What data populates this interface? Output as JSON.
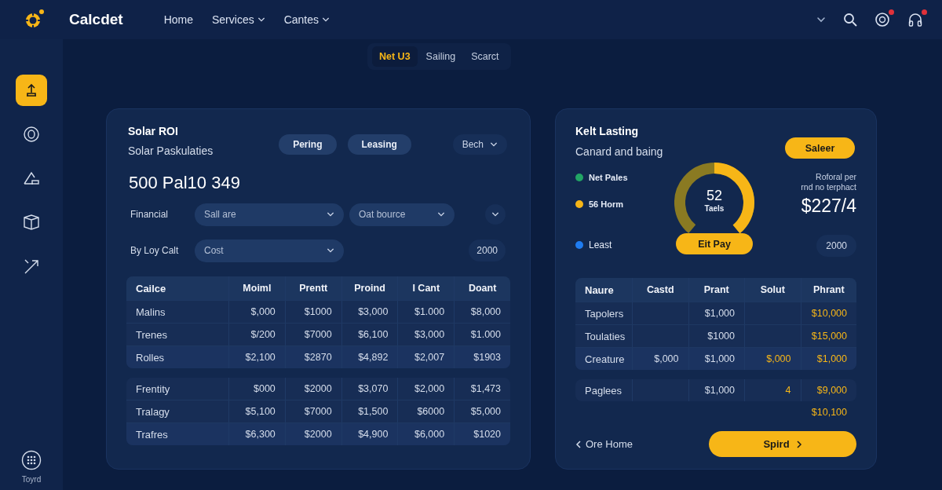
{
  "header": {
    "brand": "Calcdet",
    "nav": [
      {
        "label": "Home",
        "dropdown": false
      },
      {
        "label": "Services",
        "dropdown": true
      },
      {
        "label": "Cantes",
        "dropdown": true
      }
    ],
    "actions": [
      {
        "kind": "chevron",
        "alert": false
      },
      {
        "kind": "search",
        "alert": false
      },
      {
        "kind": "support",
        "alert": true
      },
      {
        "kind": "headset",
        "alert": true
      }
    ]
  },
  "sidebar": {
    "items": [
      {
        "kind": "upload",
        "selected": true
      },
      {
        "kind": "circle",
        "selected": false
      },
      {
        "kind": "triangle",
        "selected": false
      },
      {
        "kind": "box",
        "selected": false
      },
      {
        "kind": "arrow",
        "selected": false
      }
    ],
    "footer": "Toyrd"
  },
  "subtabs": [
    {
      "label": "Net U3",
      "selected": true
    },
    {
      "label": "Sailing",
      "selected": false
    },
    {
      "label": "Scarct",
      "selected": false
    }
  ],
  "roi_card": {
    "title": "Solar ROI",
    "subtitle": "Solar Paskulaties",
    "toggles": [
      "Pering",
      "Leasing"
    ],
    "period": "Bech",
    "figure": "500 Pal10 349",
    "fields": [
      {
        "label": "Financial",
        "selects": [
          "Sall are",
          "Oat bource"
        ],
        "kind": "chevron"
      },
      {
        "label": "By Loy Calt",
        "selects": [
          "Cost"
        ],
        "kind": "value",
        "value": "2000"
      }
    ],
    "table": {
      "columns": [
        "Cailce",
        "Moiml",
        "Prentt",
        "Proind",
        "I Cant",
        "Doant"
      ],
      "groups": [
        [
          [
            "Malins",
            "$,000",
            "$1000",
            "$3,000",
            "$1.000",
            "$8,000"
          ],
          [
            "Trenes",
            "$/200",
            "$7000",
            "$6,100",
            "$3,000",
            "$1.000"
          ],
          [
            "Rolles",
            "$2,100",
            "$2870",
            "$4,892",
            "$2,007",
            "$1903"
          ]
        ],
        [
          [
            "Frentity",
            "$000",
            "$2000",
            "$3,070",
            "$2,000",
            "$1,473"
          ],
          [
            "Tralagy",
            "$5,100",
            "$7000",
            "$1,500",
            "$6000",
            "$5,000"
          ],
          [
            "Trafres",
            "$6,300",
            "$2000",
            "$4,900",
            "$6,000",
            "$1020"
          ]
        ]
      ]
    }
  },
  "lease_card": {
    "title": "Kelt Lasting",
    "subtitle": "Canard and baing",
    "action": "Saleer",
    "legend": [
      {
        "label": "Net Pales",
        "color": "#22a565"
      },
      {
        "label": "56 Horm",
        "color": "#f5b517"
      },
      {
        "label": "Least",
        "color": "#1f7cf0"
      }
    ],
    "gauge": {
      "value": "52",
      "label": "Taels",
      "level": 0.5
    },
    "pay_button": "Eit Pay",
    "note": [
      "Roforal per",
      "rnd no terphact"
    ],
    "amount": "$227/4",
    "value": "2000",
    "table": {
      "columns": [
        "Naure",
        "Castd",
        "Prant",
        "Solut",
        "Phrant"
      ],
      "groups": [
        [
          {
            "column_1": {
              "text": "Tapolers",
              "accent": false
            },
            "column_3": {
              "text": "$1,000",
              "accent": false
            },
            "column_5": {
              "text": "$10,000",
              "accent": true
            }
          },
          {
            "column_1": {
              "text": "Toulaties",
              "accent": false
            },
            "column_3": {
              "text": "$1000",
              "accent": false
            },
            "column_5": {
              "text": "$15,000",
              "accent": true
            }
          },
          {
            "column_1": {
              "text": "Creature",
              "accent": false
            },
            "column_2": {
              "text": "$,000",
              "accent": false
            },
            "column_3": {
              "text": "$1,000",
              "accent": false
            },
            "column_4": {
              "text": "$,000",
              "accent": true
            },
            "column_5": {
              "text": "$1,000",
              "accent": true
            }
          }
        ],
        [
          {
            "column_1": {
              "text": "Paglees",
              "accent": false
            },
            "column_3": {
              "text": "$1,000",
              "accent": false
            },
            "column_4": {
              "text": "4",
              "accent": true
            },
            "column_5": {
              "text": "$9,000",
              "accent": true
            }
          }
        ]
      ],
      "total": {
        "text": "$10,100",
        "accent": true
      }
    },
    "back_link": "Ore Home",
    "next_button": "Spird"
  }
}
